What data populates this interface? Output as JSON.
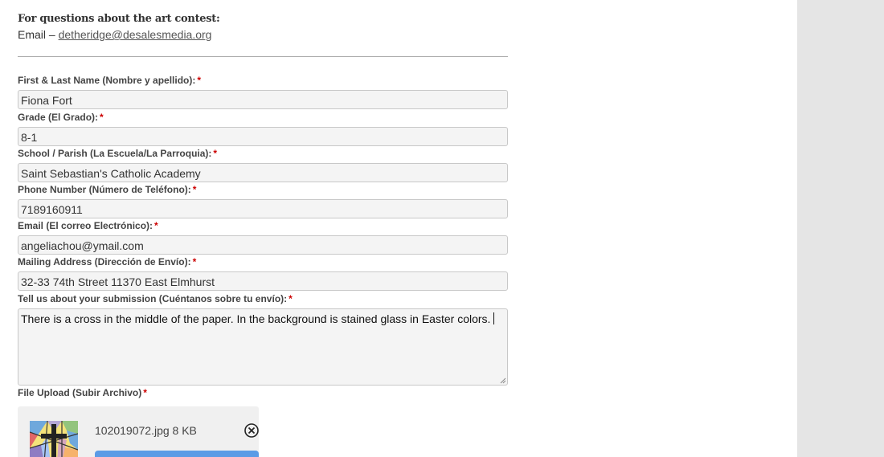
{
  "contact": {
    "heading": "For questions about the art contest:",
    "email_prefix": "Email – ",
    "email_link": "detheridge@desalesmedia.org"
  },
  "required_mark": "*",
  "fields": {
    "name": {
      "label": "First & Last Name (Nombre y apellido):",
      "value": "Fiona Fort"
    },
    "grade": {
      "label": "Grade (El Grado):",
      "value": "8-1"
    },
    "school": {
      "label": "School / Parish (La Escuela/La Parroquia):",
      "value": "Saint Sebastian's Catholic Academy"
    },
    "phone": {
      "label": "Phone Number (Número de Teléfono):",
      "value": "7189160911"
    },
    "email": {
      "label": "Email (El correo Electrónico):",
      "value": "angeliachou@ymail.com"
    },
    "address": {
      "label": "Mailing Address (Dirección de Envío):",
      "value": "32-33 74th Street 11370 East Elmhurst"
    },
    "submission": {
      "label": "Tell us about your submission (Cuéntanos sobre tu envío):",
      "value": "There is a cross in the middle of the paper. In the background is stained glass in Easter colors."
    }
  },
  "upload": {
    "label": "File Upload (Subir Archivo)",
    "file_name": "102019072.jpg",
    "file_size": "8 KB",
    "thumbnail_icon": "stained-glass-cross-thumbnail",
    "remove_icon": "circle-x-icon"
  },
  "colors": {
    "required": "#cc0000",
    "input_bg": "#f4f4f4",
    "gutter": "#e5e5e5",
    "upload_button": "#5b9be6"
  }
}
